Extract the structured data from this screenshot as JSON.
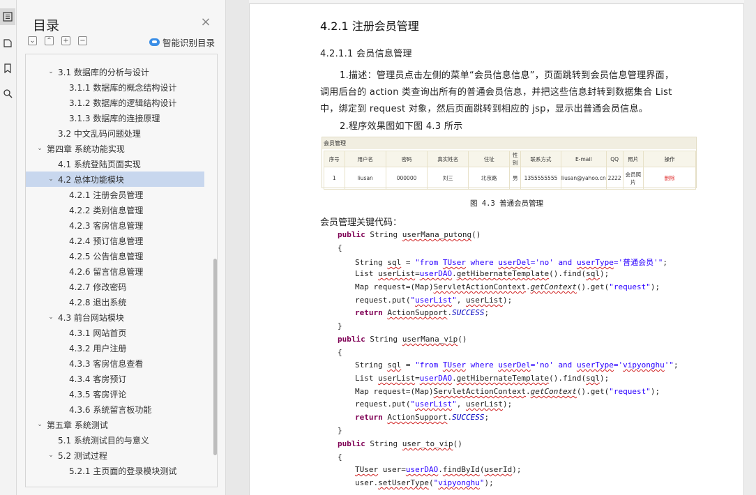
{
  "toc": {
    "title": "目录",
    "smart_label": "智能识别目录",
    "items": [
      {
        "label": "3.1 数据库的分析与设计",
        "level": 2,
        "caret": "open"
      },
      {
        "label": "3.1.1 数据库的概念结构设计",
        "level": 3,
        "caret": ""
      },
      {
        "label": "3.1.2 数据库的逻辑结构设计",
        "level": 3,
        "caret": ""
      },
      {
        "label": "3.1.3 数据库的连接原理",
        "level": 3,
        "caret": ""
      },
      {
        "label": "3.2 中文乱码问题处理",
        "level": 2,
        "caret": ""
      },
      {
        "label": "第四章  系统功能实现",
        "level": 1,
        "caret": "open"
      },
      {
        "label": "4.1 系统登陆页面实现",
        "level": 2,
        "caret": ""
      },
      {
        "label": "4.2 总体功能模块",
        "level": 2,
        "caret": "open",
        "selected": true
      },
      {
        "label": "4.2.1 注册会员管理",
        "level": 3,
        "caret": ""
      },
      {
        "label": "4.2.2 类别信息管理",
        "level": 3,
        "caret": ""
      },
      {
        "label": "4.2.3 客房信息管理",
        "level": 3,
        "caret": ""
      },
      {
        "label": "4.2.4 预订信息管理",
        "level": 3,
        "caret": ""
      },
      {
        "label": "4.2.5 公告信息管理",
        "level": 3,
        "caret": ""
      },
      {
        "label": "4.2.6 留言信息管理",
        "level": 3,
        "caret": ""
      },
      {
        "label": "4.2.7 修改密码",
        "level": 3,
        "caret": ""
      },
      {
        "label": "4.2.8 退出系统",
        "level": 3,
        "caret": ""
      },
      {
        "label": "4.3 前台网站模块",
        "level": 2,
        "caret": "open"
      },
      {
        "label": "4.3.1 网站首页",
        "level": 3,
        "caret": ""
      },
      {
        "label": "4.3.2 用户注册",
        "level": 3,
        "caret": ""
      },
      {
        "label": "4.3.3 客房信息查看",
        "level": 3,
        "caret": ""
      },
      {
        "label": "4.3.4 客房预订",
        "level": 3,
        "caret": ""
      },
      {
        "label": "4.3.5 客房评论",
        "level": 3,
        "caret": ""
      },
      {
        "label": "4.3.6 系统留言板功能",
        "level": 3,
        "caret": ""
      },
      {
        "label": "第五章  系统测试",
        "level": 1,
        "caret": "open"
      },
      {
        "label": "5.1 系统测试目的与意义",
        "level": 2,
        "caret": ""
      },
      {
        "label": "5.2 测试过程",
        "level": 2,
        "caret": "open"
      },
      {
        "label": "5.2.1 主页面的登录模块测试",
        "level": 3,
        "caret": ""
      }
    ]
  },
  "doc": {
    "heading": "4.2.1 注册会员管理",
    "subheading": "4.2.1.1 会员信息管理",
    "para1_line1": "1.描述：管理员点击左侧的菜单“会员信息信息”，页面跳转到会员信息管理界面，",
    "para1_line2": "调用后台的 action 类查询出所有的普通会员信息，并把这些信息封转到数据集合 List",
    "para1_line3": "中，绑定到 request 对象，然后页面跳转到相应的 jsp，显示出普通会员信息。",
    "para2": "2.程序效果图如下图 4.3 所示",
    "figure": {
      "panel_title": "会员管理",
      "headers": [
        "序号",
        "用户名",
        "密码",
        "真实姓名",
        "住址",
        "性别",
        "联系方式",
        "E-mail",
        "QQ",
        "照片",
        "操作"
      ],
      "row": [
        "1",
        "liusan",
        "000000",
        "刘三",
        "北京路",
        "男",
        "1355555555",
        "liusan@yahoo.cn",
        "2222",
        "会员照片",
        "删除"
      ]
    },
    "caption": "图 4.3  普通会员管理",
    "code_label": "会员管理关键代码："
  }
}
